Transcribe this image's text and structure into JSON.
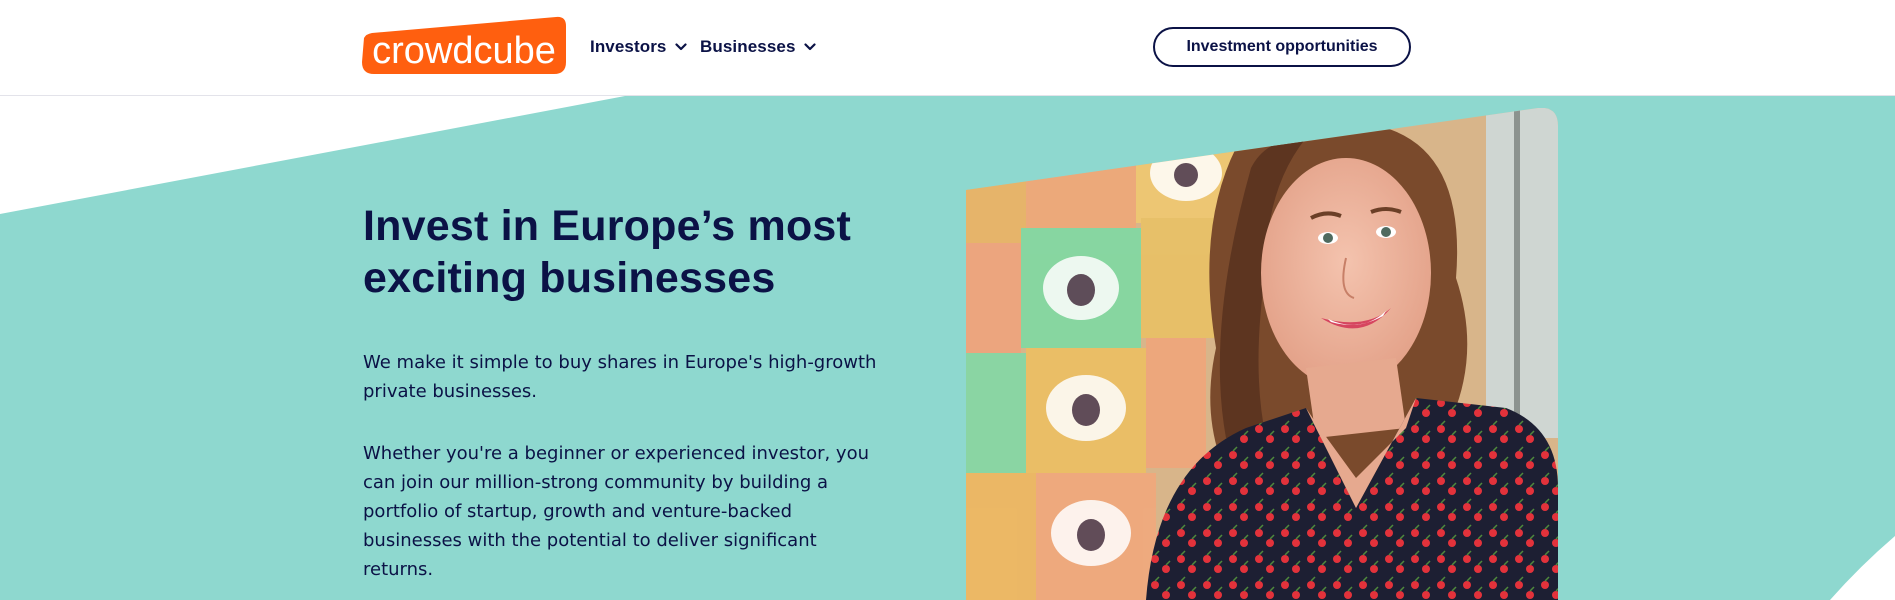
{
  "header": {
    "logo_text": "crowdcube",
    "nav": [
      {
        "label": "Investors"
      },
      {
        "label": "Businesses"
      }
    ],
    "cta_label": "Investment opportunities"
  },
  "hero": {
    "title": "Invest in Europe’s most exciting businesses",
    "paragraphs": [
      "We make it simple to buy shares in Europe's high-growth private businesses.",
      "Whether you're a beginner or experienced investor, you can join our million-strong community by building a portfolio of startup, growth and venture-backed businesses with the potential to deliver significant returns."
    ]
  },
  "colors": {
    "brand_orange": "#ff5f0f",
    "navy": "#0b1246",
    "teal": "#8ed8cf"
  }
}
